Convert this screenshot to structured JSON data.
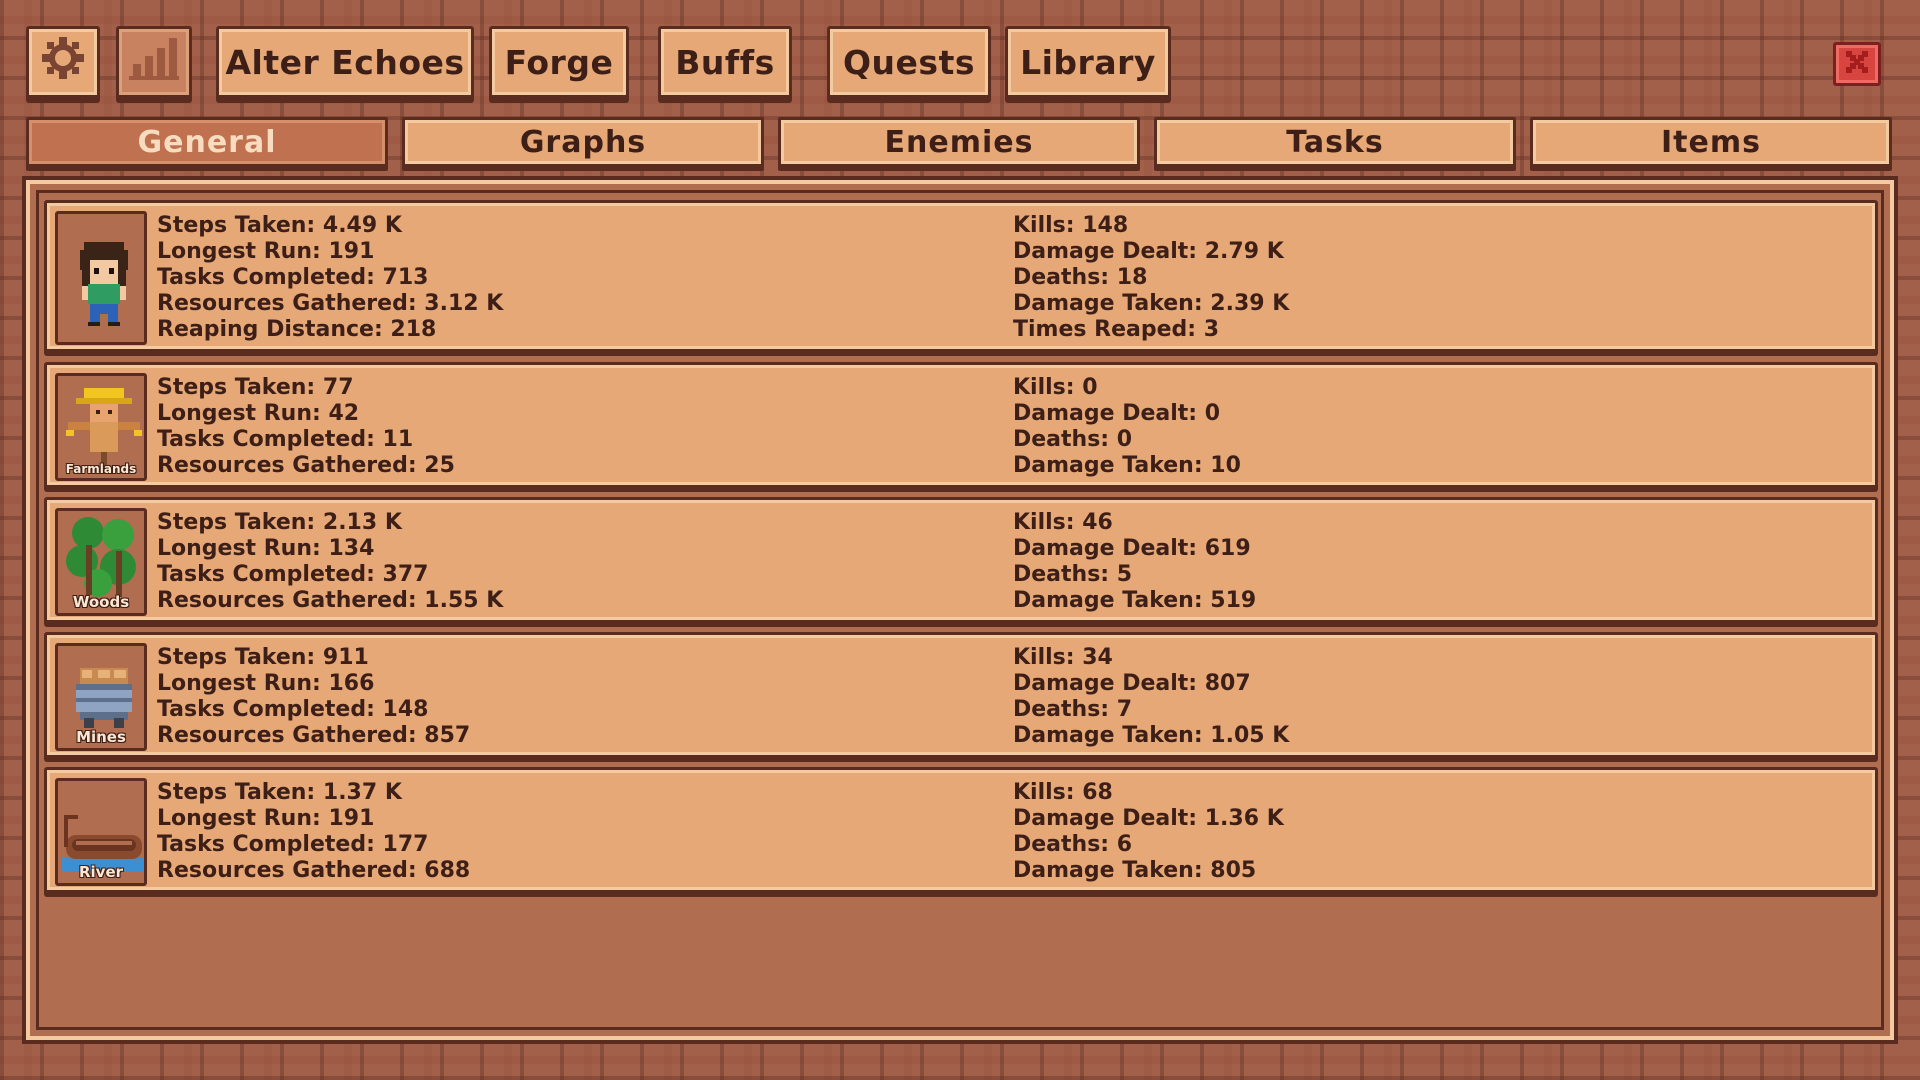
{
  "toolbar": {
    "settings_icon": "gear-icon",
    "stats_icon": "bar-chart-icon",
    "buttons": [
      "Alter Echoes",
      "Forge",
      "Buffs",
      "Quests",
      "Library"
    ],
    "close_icon": "close-icon"
  },
  "tabs": {
    "items": [
      "General",
      "Graphs",
      "Enemies",
      "Tasks",
      "Items"
    ],
    "active": "General"
  },
  "rows": [
    {
      "icon": "character-portrait-icon",
      "label": "",
      "left": [
        "Steps Taken: 4.49 K",
        "Longest Run: 191",
        "Tasks Completed: 713",
        "Resources Gathered: 3.12 K",
        "Reaping Distance: 218"
      ],
      "right": [
        "Kills: 148",
        "Damage Dealt: 2.79 K",
        "Deaths: 18",
        "Damage Taken: 2.39 K",
        "Times Reaped: 3"
      ]
    },
    {
      "icon": "scarecrow-icon",
      "label": "Farmlands",
      "left": [
        "Steps Taken: 77",
        "Longest Run: 42",
        "Tasks Completed: 11",
        "Resources Gathered: 25"
      ],
      "right": [
        "Kills: 0",
        "Damage Dealt: 0",
        "Deaths: 0",
        "Damage Taken: 10"
      ]
    },
    {
      "icon": "trees-icon",
      "label": "Woods",
      "left": [
        "Steps Taken: 2.13 K",
        "Longest Run: 134",
        "Tasks Completed: 377",
        "Resources Gathered: 1.55 K"
      ],
      "right": [
        "Kills: 46",
        "Damage Dealt: 619",
        "Deaths: 5",
        "Damage Taken: 519"
      ]
    },
    {
      "icon": "minecart-icon",
      "label": "Mines",
      "left": [
        "Steps Taken: 911",
        "Longest Run: 166",
        "Tasks Completed: 148",
        "Resources Gathered: 857"
      ],
      "right": [
        "Kills: 34",
        "Damage Dealt: 807",
        "Deaths: 7",
        "Damage Taken: 1.05 K"
      ]
    },
    {
      "icon": "boat-icon",
      "label": "River",
      "left": [
        "Steps Taken: 1.37 K",
        "Longest Run: 191",
        "Tasks Completed: 177",
        "Resources Gathered: 688"
      ],
      "right": [
        "Kills: 68",
        "Damage Dealt: 1.36 K",
        "Deaths: 6",
        "Damage Taken: 805"
      ]
    }
  ],
  "colors": {
    "panel_light": "#e6a877",
    "panel_dark": "#b06d50",
    "outline": "#5a2c20",
    "text": "#3d1f17",
    "close": "#d8443f"
  }
}
